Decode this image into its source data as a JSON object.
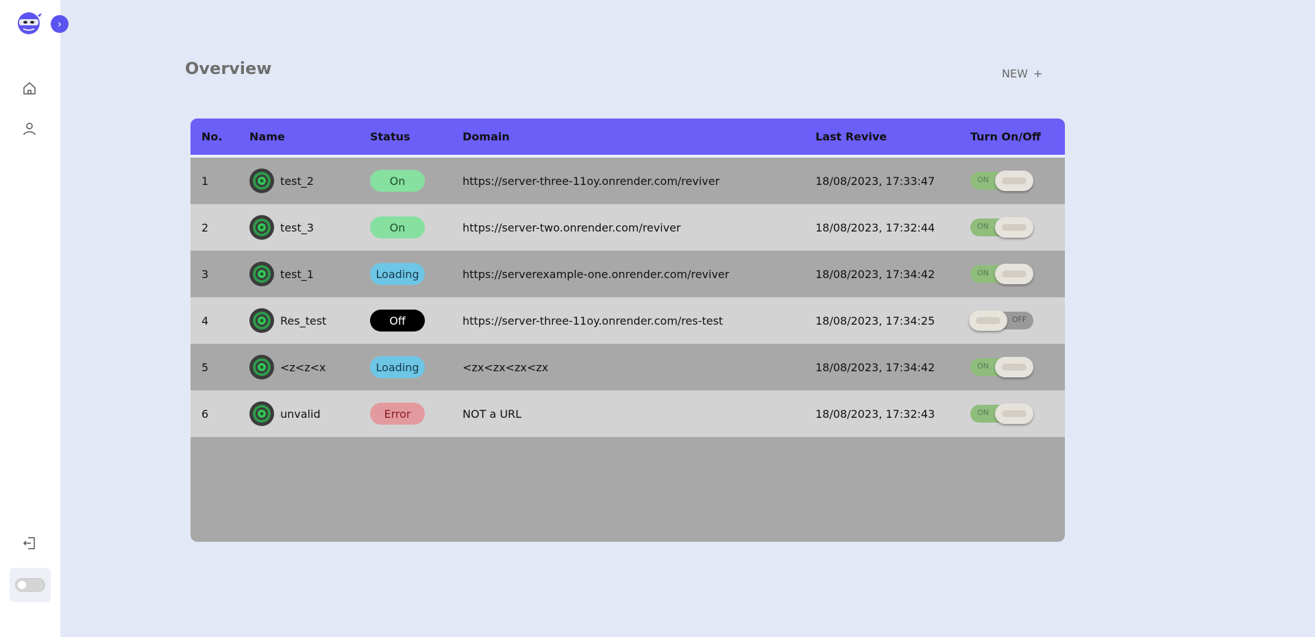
{
  "sidebar": {
    "logo": "ninja-logo",
    "expand_icon": "chevron-right-icon",
    "expand_glyph": "›",
    "items": [
      {
        "icon": "home-icon"
      },
      {
        "icon": "user-icon"
      }
    ],
    "logout_icon": "logout-icon",
    "theme_toggle": "off"
  },
  "header": {
    "title": "Overview",
    "new_label": "NEW",
    "new_glyph": "+"
  },
  "table": {
    "columns": [
      "No.",
      "Name",
      "Status",
      "Domain",
      "Last Revive",
      "Turn On/Off"
    ],
    "rows": [
      {
        "no": "1",
        "name": "test_2",
        "status": "On",
        "status_type": "on",
        "domain": "https://server-three-11oy.onrender.com/reviver",
        "last_revive": "18/08/2023, 17:33:47",
        "toggle": "ON",
        "toggle_on": true
      },
      {
        "no": "2",
        "name": "test_3",
        "status": "On",
        "status_type": "on",
        "domain": "https://server-two.onrender.com/reviver",
        "last_revive": "18/08/2023, 17:32:44",
        "toggle": "ON",
        "toggle_on": true
      },
      {
        "no": "3",
        "name": "test_1",
        "status": "Loading",
        "status_type": "loading",
        "domain": "https://serverexample-one.onrender.com/reviver",
        "last_revive": "18/08/2023, 17:34:42",
        "toggle": "ON",
        "toggle_on": true
      },
      {
        "no": "4",
        "name": "Res_test",
        "status": "Off",
        "status_type": "off",
        "domain": "https://server-three-11oy.onrender.com/res-test",
        "last_revive": "18/08/2023, 17:34:25",
        "toggle": "OFF",
        "toggle_on": false
      },
      {
        "no": "5",
        "name": "<z<z<x",
        "status": "Loading",
        "status_type": "loading",
        "domain": "<zx<zx<zx<zx",
        "last_revive": "18/08/2023, 17:34:42",
        "toggle": "ON",
        "toggle_on": true
      },
      {
        "no": "6",
        "name": "unvalid",
        "status": "Error",
        "status_type": "error",
        "domain": "NOT a URL",
        "last_revive": "18/08/2023, 17:32:43",
        "toggle": "ON",
        "toggle_on": true
      }
    ]
  },
  "colors": {
    "accent": "#6b5ff8",
    "background": "#e3e8f6",
    "row_dark": "#a8a8a8",
    "row_light": "#d3d3d3"
  }
}
